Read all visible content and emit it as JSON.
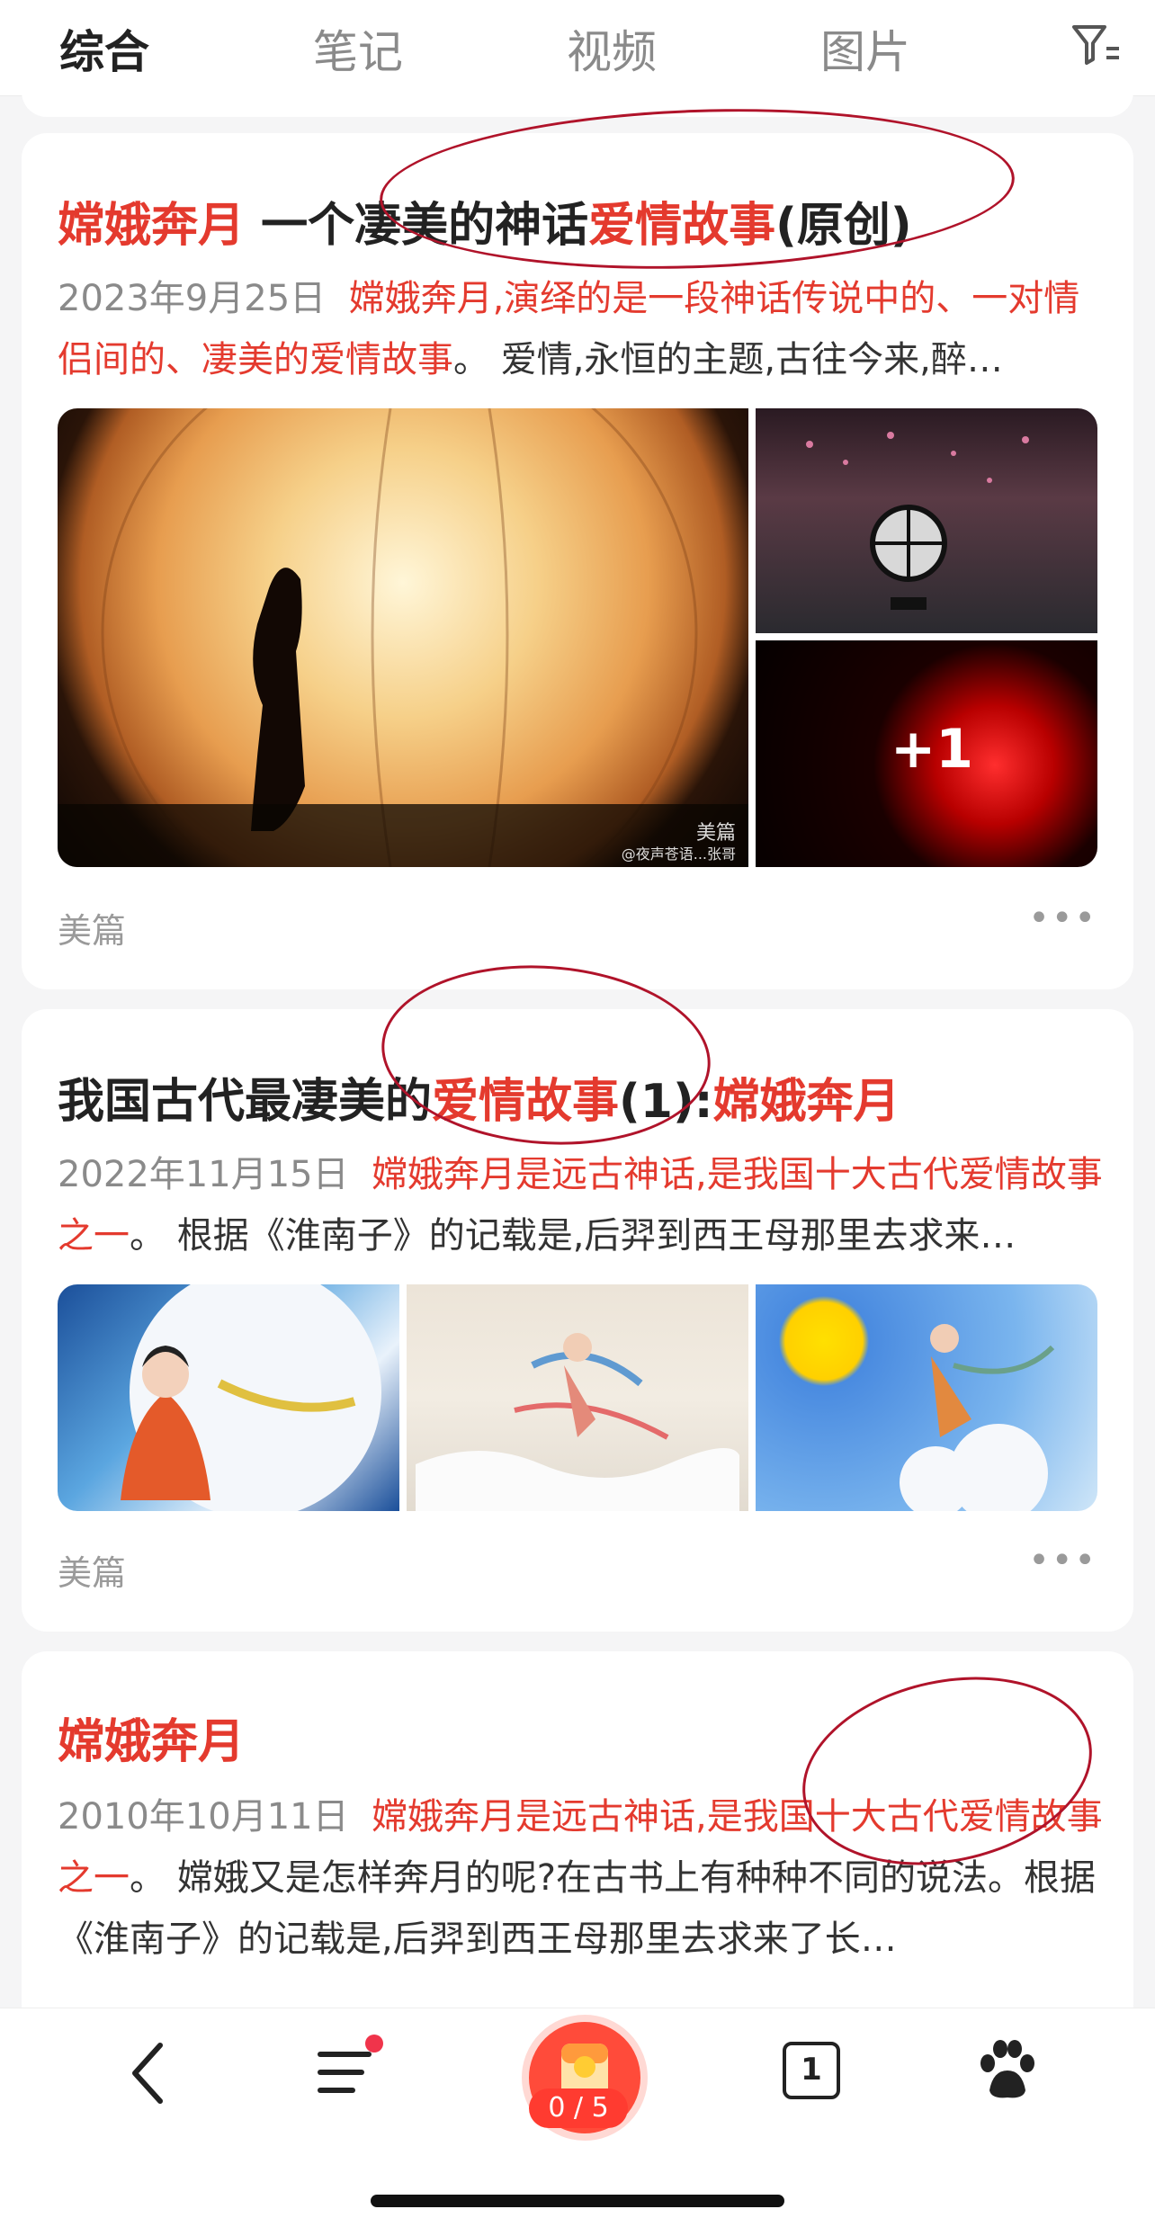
{
  "tabs": {
    "items": [
      "综合",
      "笔记",
      "视频",
      "图片"
    ],
    "active": "综合"
  },
  "results": [
    {
      "title_parts": [
        {
          "text": "嫦娥奔月",
          "hl": true
        },
        {
          "text": " 一个凄美的神话",
          "hl": false
        },
        {
          "text": "爱情故事",
          "hl": true
        },
        {
          "text": "(原创)",
          "hl": false
        }
      ],
      "date": "2023年9月25日",
      "snippet_hl": "嫦娥奔月,演绎的是一段神话传说中的、一对情侣间的、凄美的爱情故事",
      "snippet_rest": "。 爱情,永恒的主题,古往今来,醉…",
      "image_more": "+1",
      "watermark": "美篇",
      "watermark_sub": "@夜声苍语...张哥",
      "source": "美篇"
    },
    {
      "title_parts": [
        {
          "text": "我国古代最凄美的",
          "hl": false
        },
        {
          "text": "爱情故事",
          "hl": true
        },
        {
          "text": "(1):",
          "hl": false
        },
        {
          "text": "嫦娥奔月",
          "hl": true
        }
      ],
      "date": "2022年11月15日",
      "snippet_hl": "嫦娥奔月是远古神话,是我国十大古代爱情故事之一",
      "snippet_rest": "。 根据《淮南子》的记载是,后羿到西王母那里去求来…",
      "source": "美篇"
    },
    {
      "title_parts": [
        {
          "text": "嫦娥奔月",
          "hl": true
        }
      ],
      "date": "2010年10月11日",
      "snippet_hl": "嫦娥奔月是远古神话,是我国十大古代爱情故事之一",
      "snippet_rest": "。 嫦娥又是怎样奔月的呢?在古书上有种种不同的说法。根据《淮南子》的记载是,后羿到西王母那里去求来了长…"
    }
  ],
  "bottom_bar": {
    "redpack_counter": "0 / 5",
    "tab_count": "1",
    "notification_dot_color": "#f0344b"
  }
}
